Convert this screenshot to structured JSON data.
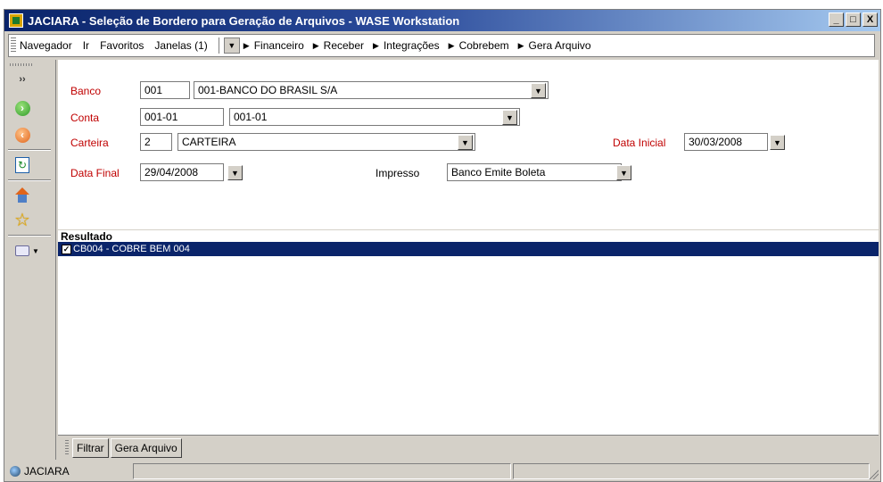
{
  "window": {
    "title": "JACIARA - Seleção de Bordero para Geração de Arquivos - WASE Workstation",
    "buttons": [
      "_",
      "□",
      "X"
    ]
  },
  "menu": {
    "items": [
      "Navegador",
      "Ir",
      "Favoritos",
      "Janelas (1)"
    ],
    "breadcrumb": [
      "Financeiro",
      "Receber",
      "Integrações",
      "Cobrebem",
      "Gera Arquivo"
    ]
  },
  "toolbar": {
    "icons": [
      "expand-icon",
      "forward-icon",
      "back-icon",
      "refresh-icon",
      "home-icon",
      "star-icon",
      "mail-icon"
    ]
  },
  "form": {
    "banco": {
      "label": "Banco",
      "code": "001",
      "name": "001-BANCO DO BRASIL S/A"
    },
    "conta": {
      "label": "Conta",
      "code": "001-01",
      "name": "001-01"
    },
    "carteira": {
      "label": "Carteira",
      "code": "2",
      "name": "CARTEIRA"
    },
    "data_inicial": {
      "label": "Data Inicial",
      "value": "30/03/2008"
    },
    "data_final": {
      "label": "Data Final",
      "value": "29/04/2008"
    },
    "impresso": {
      "label": "Impresso",
      "value": "Banco Emite Boleta"
    }
  },
  "result": {
    "header": "Resultado",
    "items": [
      {
        "label": "CB004 - COBRE BEM 004",
        "checked": "✓"
      }
    ]
  },
  "bottom_tabs": [
    "Filtrar",
    "Gera Arquivo"
  ],
  "status": {
    "user": "JACIARA"
  },
  "colors": {
    "title_start": "#0a246a",
    "title_end": "#a6caf0",
    "label_red": "#c00000",
    "selection": "#0a246a",
    "chrome": "#d4d0c8"
  }
}
